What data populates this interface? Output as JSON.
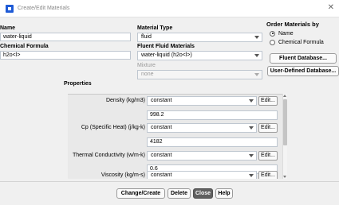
{
  "window": {
    "title": "Create/Edit Materials"
  },
  "name": {
    "label": "Name",
    "value": "water-liquid"
  },
  "chemical_formula": {
    "label": "Chemical Formula",
    "value": "h2o<l>"
  },
  "material_type": {
    "label": "Material Type",
    "value": "fluid"
  },
  "fluent_fluid_materials": {
    "label": "Fluent Fluid Materials",
    "value": "water-liquid (h2o<l>)"
  },
  "mixture": {
    "label": "Mixture",
    "value": "none"
  },
  "order_by": {
    "label": "Order Materials by",
    "options": [
      {
        "label": "Name",
        "selected": true
      },
      {
        "label": "Chemical Formula",
        "selected": false
      }
    ]
  },
  "database_buttons": {
    "fluent": "Fluent Database...",
    "user_defined": "User-Defined Database..."
  },
  "properties": {
    "label": "Properties",
    "edit_label": "Edit...",
    "items": [
      {
        "label": "Density (kg/m3)",
        "method": "constant",
        "value": "998.2"
      },
      {
        "label": "Cp (Specific Heat) (j/kg-k)",
        "method": "constant",
        "value": "4182"
      },
      {
        "label": "Thermal Conductivity (w/m-k)",
        "method": "constant",
        "value": "0.6"
      },
      {
        "label": "Viscosity (kg/m-s)",
        "method": "constant"
      }
    ]
  },
  "footer_buttons": {
    "change_create": "Change/Create",
    "delete": "Delete",
    "close": "Close",
    "help": "Help"
  },
  "colors": {
    "primary_button": "#606060",
    "app_icon": "#1f5bd6"
  }
}
